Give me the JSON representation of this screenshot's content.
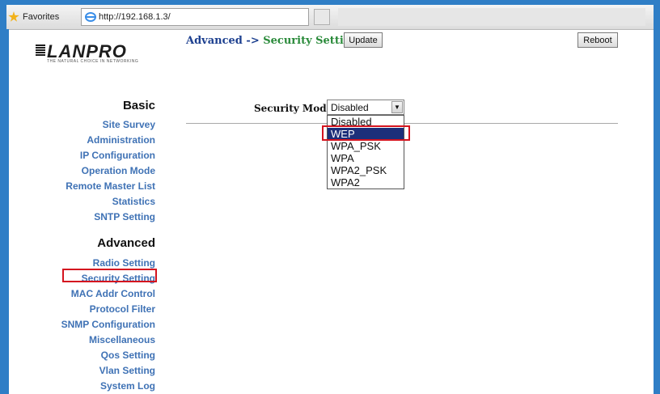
{
  "browser": {
    "favorites_label": "Favorites",
    "tab_url": "http://192.168.1.3/"
  },
  "brand": {
    "logo_text": "LANPRO",
    "tagline": "THE NATURAL CHOICE IN NETWORKING"
  },
  "sidebar": {
    "basic_heading": "Basic",
    "basic_items": [
      {
        "label": "Site Survey"
      },
      {
        "label": "Administration"
      },
      {
        "label": "IP Configuration"
      },
      {
        "label": "Operation Mode"
      },
      {
        "label": "Remote Master List"
      },
      {
        "label": "Statistics"
      },
      {
        "label": "SNTP Setting"
      }
    ],
    "advanced_heading": "Advanced",
    "advanced_items": [
      {
        "label": "Radio Setting"
      },
      {
        "label": "Security Setting"
      },
      {
        "label": "MAC Addr Control"
      },
      {
        "label": "Protocol Filter"
      },
      {
        "label": "SNMP Configuration"
      },
      {
        "label": "Miscellaneous"
      },
      {
        "label": "Qos Setting"
      },
      {
        "label": "Vlan Setting"
      },
      {
        "label": "System Log"
      }
    ]
  },
  "header": {
    "section": "Advanced",
    "arrow": "->",
    "current": "Security Setting",
    "update_label": "Update",
    "reboot_label": "Reboot"
  },
  "security": {
    "mode_label": "Security Mode:",
    "selected": "Disabled",
    "options": [
      "Disabled",
      "WEP",
      "WPA_PSK",
      "WPA",
      "WPA2_PSK",
      "WPA2"
    ],
    "highlighted_option": "WEP"
  },
  "colors": {
    "frame_blue": "#2f7ec6",
    "nav_link": "#3f72b5",
    "highlight_red": "#d4141f",
    "option_selected_bg": "#1c2f7a"
  }
}
